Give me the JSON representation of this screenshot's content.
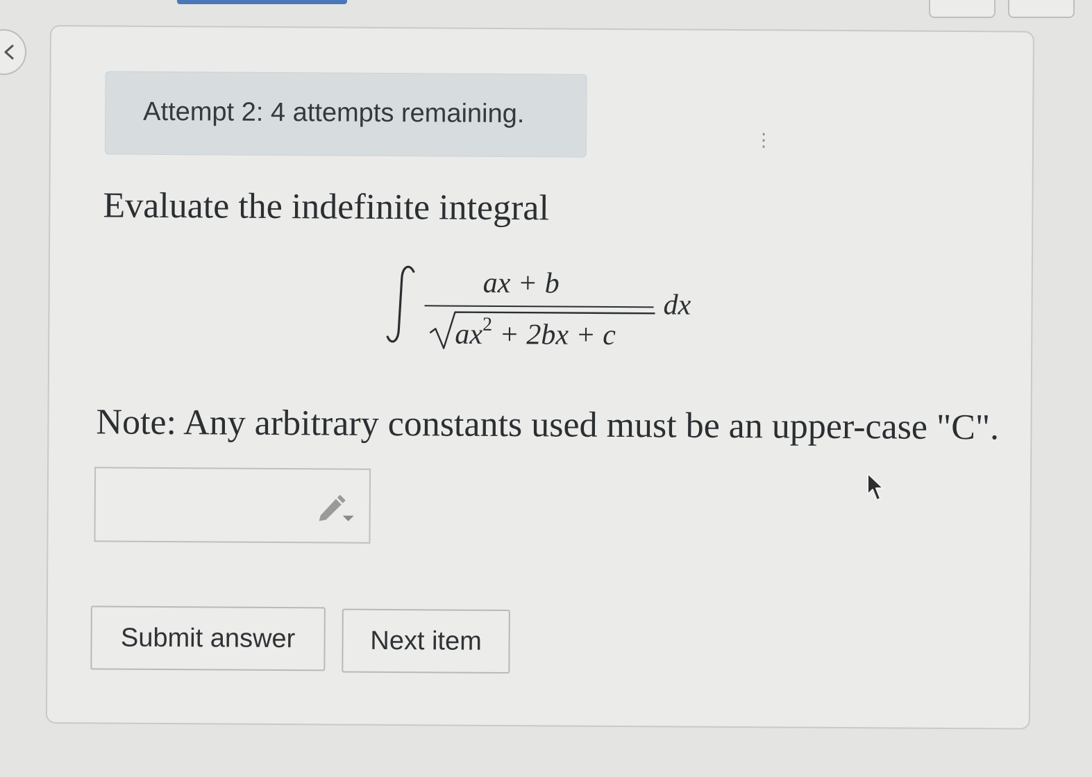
{
  "banner": {
    "attempt_text": "Attempt 2: 4 attempts remaining."
  },
  "question": {
    "prompt": "Evaluate the indefinite integral",
    "formula": {
      "integral_symbol": "∫",
      "numerator": "ax + b",
      "denominator_base": "ax",
      "denominator_exponent": "2",
      "denominator_rest": " + 2bx + c",
      "differential": "dx"
    },
    "note": "Note: Any arbitrary constants used must be an upper-case \"C\"."
  },
  "answer": {
    "value": "",
    "editor_icon": "pencil-icon"
  },
  "actions": {
    "submit_label": "Submit answer",
    "next_label": "Next item"
  },
  "navigation": {
    "back_icon": "chevron-left-icon"
  },
  "colors": {
    "background": "#e4e4e2",
    "card": "#ebebe9",
    "banner": "#d7dcdf",
    "accent": "#4a78b8",
    "text": "#2b2f32"
  }
}
